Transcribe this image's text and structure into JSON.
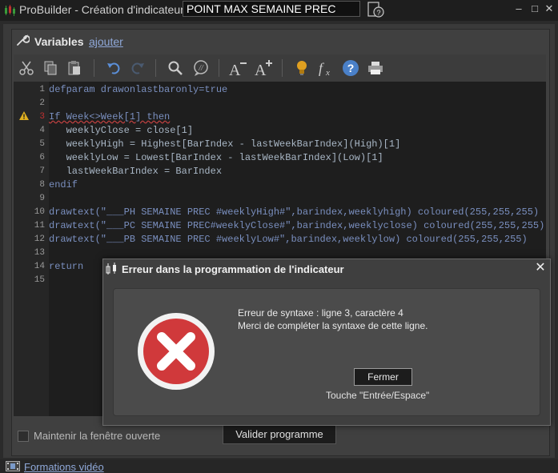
{
  "window": {
    "title": "ProBuilder - Création d'indicateur",
    "indicator_name": "POINT MAX SEMAINE PREC",
    "minimize": "–",
    "restore": "□",
    "close": "✕"
  },
  "variables": {
    "label": "Variables",
    "add_link": "ajouter"
  },
  "toolbar": {
    "icons": [
      "scissors-icon",
      "copy-icon",
      "paste-icon",
      "undo-icon",
      "redo-icon",
      "search-icon",
      "comment-icon",
      "font-decrease-icon",
      "font-increase-icon",
      "lightbulb-icon",
      "function-icon",
      "help-icon",
      "print-icon"
    ]
  },
  "editor": {
    "line_numbers": [
      "1",
      "2",
      "3",
      "4",
      "5",
      "6",
      "7",
      "8",
      "9",
      "10",
      "11",
      "12",
      "13",
      "14",
      "15"
    ],
    "warning_line": "3",
    "lines": [
      "defparam drawonlastbaronly=true",
      "",
      "If Week<>Week[1] then",
      "   weeklyClose = close[1]",
      "   weeklyHigh = Highest[BarIndex - lastWeekBarIndex](High)[1]",
      "   weeklyLow = Lowest[BarIndex - lastWeekBarIndex](Low)[1]",
      "   lastWeekBarIndex = BarIndex",
      "endif",
      "",
      "drawtext(\"___PH SEMAINE PREC #weeklyHigh#\",barindex,weeklyhigh) coloured(255,255,255)",
      "drawtext(\"___PC SEMAINE PREC#weeklyClose#\",barindex,weeklyclose) coloured(255,255,255)",
      "drawtext(\"___PB SEMAINE PREC #weeklyLow#\",barindex,weeklylow) coloured(255,255,255)",
      "",
      "return",
      ""
    ]
  },
  "footer": {
    "keep_open_label": "Maintenir la fenêtre ouverte",
    "keep_open_checked": false,
    "validate_button": "Valider programme"
  },
  "statusbar": {
    "video_link": "Formations vidéo"
  },
  "dialog": {
    "title": "Erreur dans la programmation de l'indicateur",
    "close": "✕",
    "message_line1": "Erreur de syntaxe : ligne 3, caractère 4",
    "message_line2": "Merci de compléter la syntaxe de cette ligne.",
    "button": "Fermer",
    "hint": "Touche \"Entrée/Espace\"",
    "icon": "error-x-icon",
    "icon_color": "#d0393b"
  },
  "colors": {
    "background": "#2b2b2b",
    "editor_bg": "#1e1e1e",
    "link": "#8fa8d8",
    "keyword": "#7a8fbf",
    "function": "#6aaa6a"
  }
}
